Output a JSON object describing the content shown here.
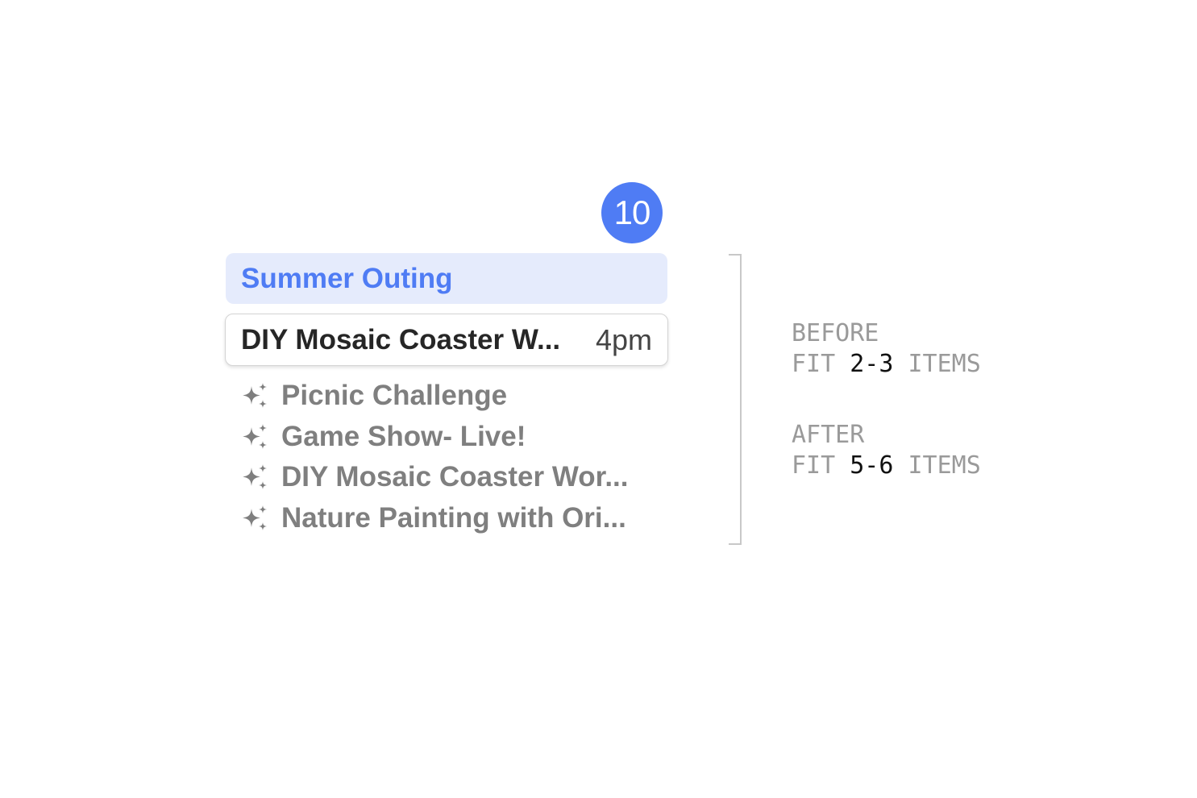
{
  "day_badge": {
    "number": "10",
    "color": "#4f7cf4"
  },
  "all_day_event": {
    "title": "Summer Outing",
    "color": "#4f7cf4",
    "background": "#e5ebfc"
  },
  "timed_event": {
    "title": "DIY Mosaic Coaster W...",
    "time": "4pm"
  },
  "suggestions": {
    "icon": "sparkle-icon",
    "items": [
      {
        "label": "Picnic Challenge"
      },
      {
        "label": "Game Show- Live!"
      },
      {
        "label": "DIY Mosaic Coaster Wor..."
      },
      {
        "label": "Nature Painting with Ori..."
      }
    ]
  },
  "annotation": {
    "before": {
      "heading": "BEFORE",
      "prefix": "FIT",
      "range": "2-3",
      "suffix": "ITEMS"
    },
    "after": {
      "heading": "AFTER",
      "prefix": "FIT",
      "range": "5-6",
      "suffix": "ITEMS"
    }
  }
}
